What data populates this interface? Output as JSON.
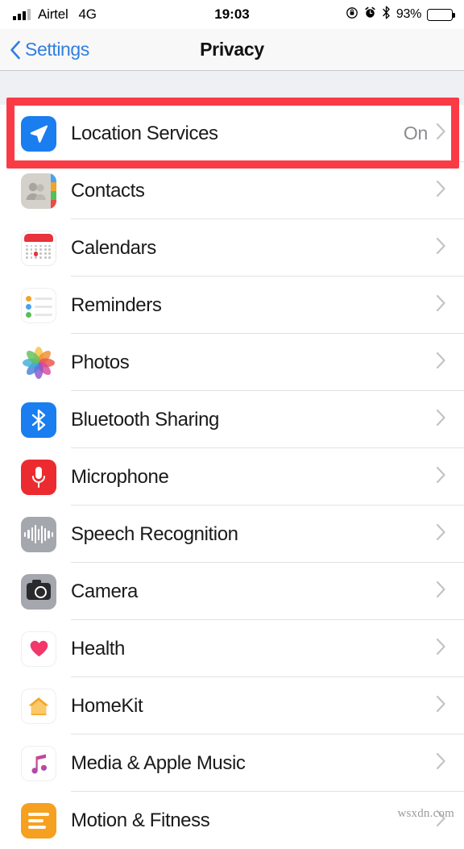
{
  "status_bar": {
    "carrier": "Airtel",
    "network": "4G",
    "time": "19:03",
    "battery_percent": "93%",
    "icons": [
      "signal-bars-icon",
      "rotation-lock-icon",
      "alarm-clock-icon",
      "bluetooth-icon",
      "battery-icon"
    ]
  },
  "nav": {
    "back_label": "Settings",
    "title": "Privacy",
    "accent_color": "#2f7fe0"
  },
  "highlight": {
    "color": "#fa3b46",
    "target": "Location Services"
  },
  "list": {
    "items": [
      {
        "label": "Location Services",
        "value": "On",
        "icon": "location-arrow-icon",
        "highlighted": true
      },
      {
        "label": "Contacts",
        "value": "",
        "icon": "contacts-icon",
        "highlighted": false
      },
      {
        "label": "Calendars",
        "value": "",
        "icon": "calendar-icon",
        "highlighted": false
      },
      {
        "label": "Reminders",
        "value": "",
        "icon": "reminders-icon",
        "highlighted": false
      },
      {
        "label": "Photos",
        "value": "",
        "icon": "photos-icon",
        "highlighted": false
      },
      {
        "label": "Bluetooth Sharing",
        "value": "",
        "icon": "bluetooth-icon",
        "highlighted": false
      },
      {
        "label": "Microphone",
        "value": "",
        "icon": "microphone-icon",
        "highlighted": false
      },
      {
        "label": "Speech Recognition",
        "value": "",
        "icon": "speech-waveform-icon",
        "highlighted": false
      },
      {
        "label": "Camera",
        "value": "",
        "icon": "camera-icon",
        "highlighted": false
      },
      {
        "label": "Health",
        "value": "",
        "icon": "heart-icon",
        "highlighted": false
      },
      {
        "label": "HomeKit",
        "value": "",
        "icon": "house-icon",
        "highlighted": false
      },
      {
        "label": "Media & Apple Music",
        "value": "",
        "icon": "music-note-icon",
        "highlighted": false
      },
      {
        "label": "Motion & Fitness",
        "value": "",
        "icon": "motion-fitness-icon",
        "highlighted": false
      }
    ]
  },
  "watermark": "wsxdn.com"
}
